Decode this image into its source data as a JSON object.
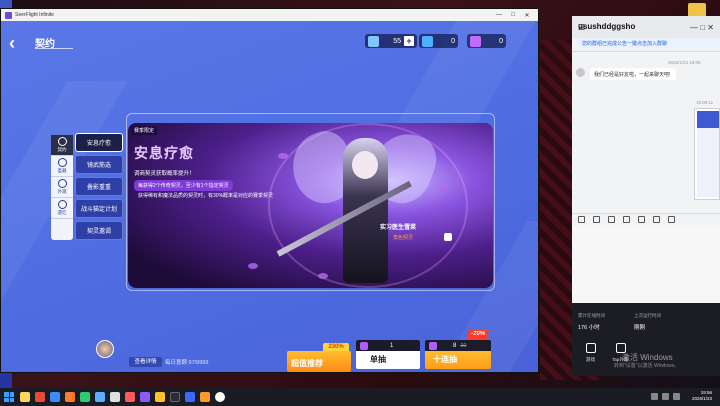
{
  "game_window": {
    "title": "SeerFlight Infinite",
    "controls": [
      "—",
      "□",
      "✕"
    ]
  },
  "header": {
    "back_icon": "back-arrow-icon",
    "title": "契约",
    "currencies": [
      {
        "icon": "crystal-icon",
        "color": "#7fc8ff",
        "value": "55",
        "has_plus": true
      },
      {
        "icon": "blue-gem-icon",
        "color": "#4fb0ff",
        "value": "0"
      },
      {
        "icon": "purple-gem-icon",
        "color": "#c26bff",
        "value": "0"
      }
    ]
  },
  "side_tabs": [
    {
      "label": "契约",
      "icon": "contract-icon",
      "active": true
    },
    {
      "label": "圣器",
      "icon": "relic-icon"
    },
    {
      "label": "外观",
      "icon": "outfit-icon"
    },
    {
      "label": "遗忆",
      "icon": "memory-icon"
    }
  ],
  "events": [
    {
      "label": "安息疗愈",
      "active": true
    },
    {
      "label": "镜武筋选"
    },
    {
      "label": "叠影重重"
    },
    {
      "label": "战斗猫定计划"
    },
    {
      "label": "契灵邀谒"
    }
  ],
  "banner": {
    "tag": "赛季限定",
    "title": "安息疗愈",
    "line1": "调商契灵获取概率提升！",
    "pill": "每获得2个传奇契灵，至少有1个指定契灵",
    "line3": "获得稀有和魔法品质的契灵时，有30%概率是对应的赛季契灵",
    "character_name": "实习医生雪莱",
    "more_link": "角色契灵"
  },
  "footer": {
    "detail_button": "查看详情",
    "daily_label": "每日意顾 97/9999",
    "recommend": {
      "label": "超值推荐",
      "badge": "230%"
    },
    "single": {
      "label": "单抽",
      "cost": "1"
    },
    "ten": {
      "label": "十连抽",
      "cost": "8",
      "old_cost": "10",
      "discount": "-20%"
    }
  },
  "chat": {
    "name": "usushddggsho",
    "notice": "您的群组已完成公告一键点击加入群聊",
    "time1": "2026/1/23 19:06",
    "message": "我们已经是好友啦，一起来聊天吧!",
    "time2": "19:09:11",
    "stats": {
      "label1": "累计在线时间",
      "value1": "176 小时",
      "label2": "上次运行时间",
      "value2": "刚刚",
      "cap1": "游戏",
      "cap2": "Tap外观"
    }
  },
  "watermark": {
    "line1": "激活 Windows",
    "line2": "转到\"设置\"以激活 Windows。"
  },
  "taskbar": {
    "time": "19:56",
    "date": "2026/1/23"
  }
}
